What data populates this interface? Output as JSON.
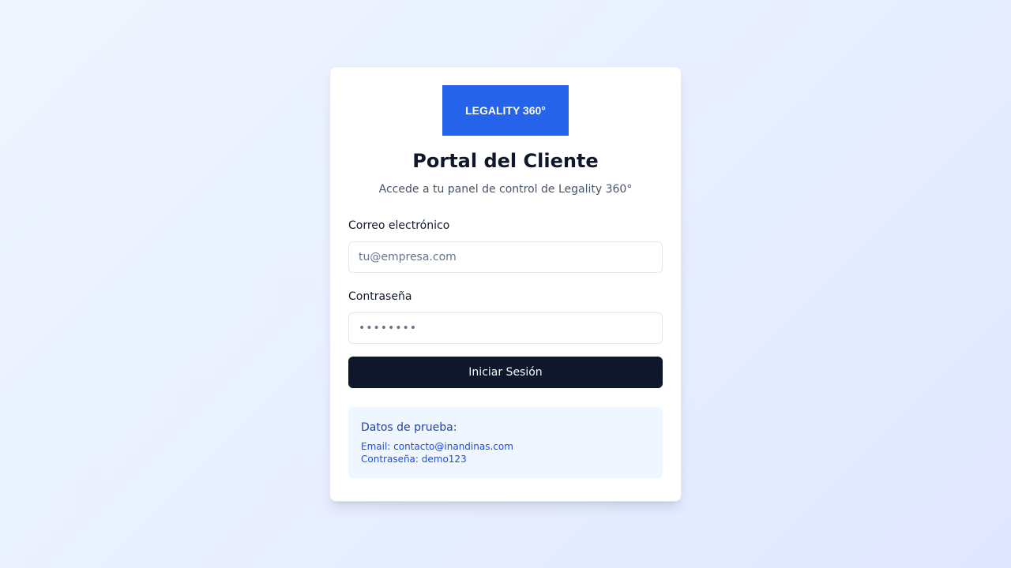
{
  "logo": {
    "text": "LEGALITY 360°"
  },
  "header": {
    "title": "Portal del Cliente",
    "subtitle": "Accede a tu panel de control de Legality 360°"
  },
  "form": {
    "email_label": "Correo electrónico",
    "email_placeholder": "tu@empresa.com",
    "password_label": "Contraseña",
    "password_placeholder": "••••••••",
    "submit_label": "Iniciar Sesión"
  },
  "demo": {
    "title": "Datos de prueba:",
    "email_line": "Email: contacto@inandinas.com",
    "password_line": "Contraseña: demo123"
  },
  "colors": {
    "brand": "#2563eb",
    "button": "#0f172a",
    "demo_background": "#eff6ff"
  }
}
